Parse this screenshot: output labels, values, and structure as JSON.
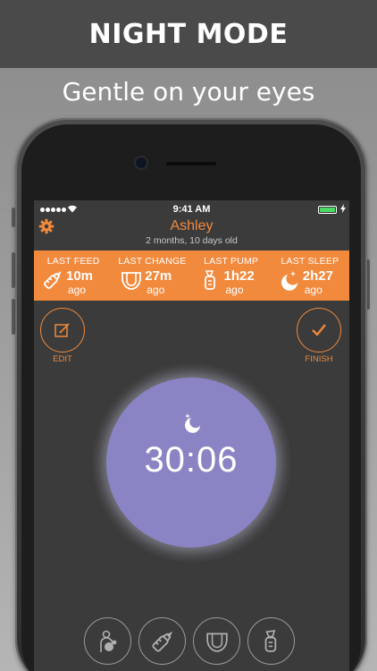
{
  "promo": {
    "title": "NIGHT MODE",
    "subtitle": "Gentle on your eyes"
  },
  "status_bar": {
    "time": "9:41 AM"
  },
  "header": {
    "baby_name": "Ashley",
    "baby_age": "2 months, 10 days old",
    "settings_icon": "gear-icon"
  },
  "stats": [
    {
      "label": "LAST FEED",
      "value": "10m",
      "unit": "ago",
      "icon": "bottle-icon"
    },
    {
      "label": "LAST CHANGE",
      "value": "27m",
      "unit": "ago",
      "icon": "diaper-icon"
    },
    {
      "label": "LAST PUMP",
      "value": "1h22",
      "unit": "ago",
      "icon": "pump-icon"
    },
    {
      "label": "LAST SLEEP",
      "value": "2h27",
      "unit": "ago",
      "icon": "moon-icon"
    }
  ],
  "controls": {
    "edit_label": "EDIT",
    "finish_label": "FINISH"
  },
  "timer": {
    "value": "30:06",
    "icon": "moon-star-icon"
  },
  "actions": [
    {
      "icon": "nursing-icon"
    },
    {
      "icon": "bottle-icon"
    },
    {
      "icon": "diaper-icon"
    },
    {
      "icon": "pump-icon"
    }
  ],
  "colors": {
    "accent": "#f28a3e",
    "timer": "#8a83c4",
    "screen_bg": "#3b3b3b"
  }
}
